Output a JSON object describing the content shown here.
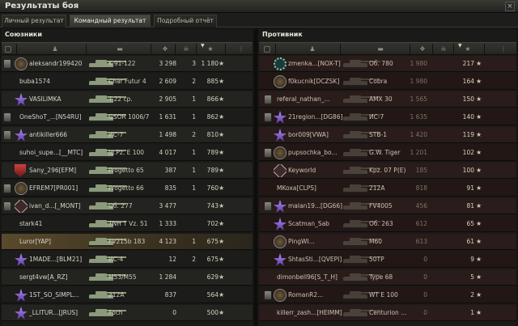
{
  "window": {
    "title": "Результаты боя",
    "close_label": "×"
  },
  "tabs": [
    {
      "label": "Личный результат",
      "active": false
    },
    {
      "label": "Командный результат",
      "active": true
    },
    {
      "label": "Подробный отчёт",
      "active": false
    }
  ],
  "allies": {
    "title": "Союзники",
    "rows": [
      {
        "name": "aleksandr199420",
        "vehicle": "K-91-122",
        "damage": "3 298",
        "frags": "3",
        "xp": "1 180",
        "badge": "plate",
        "icon": "round"
      },
      {
        "name": "buba1574",
        "vehicle": "Char Futur 4",
        "damage": "2 609",
        "frags": "2",
        "xp": "885",
        "badge": "",
        "icon": ""
      },
      {
        "name": "VASILIMKA",
        "vehicle": "T-22 ср.",
        "damage": "2 905",
        "frags": "1",
        "xp": "866",
        "badge": "",
        "icon": "star"
      },
      {
        "name": "OneShoT_...[N54RU]",
        "vehicle": "GSOR 1006/7",
        "damage": "1 631",
        "frags": "1",
        "xp": "862",
        "badge": "plate",
        "icon": ""
      },
      {
        "name": "antikiller666",
        "vehicle": "ИС-7",
        "damage": "1 498",
        "frags": "2",
        "xp": "810",
        "badge": "plate",
        "icon": "star"
      },
      {
        "name": "suhoi_supe...[__MTC]",
        "vehicle": "Jg.Pz. E 100",
        "damage": "4 017",
        "frags": "1",
        "xp": "789",
        "badge": "",
        "icon": ""
      },
      {
        "name": "Sany_296[EFM]",
        "vehicle": "Progetto 65",
        "damage": "387",
        "frags": "1",
        "xp": "789",
        "badge": "",
        "icon": "shield"
      },
      {
        "name": "EFREM7[PR001]",
        "vehicle": "Progetto 66",
        "damage": "835",
        "frags": "1",
        "xp": "760",
        "badge": "plate",
        "icon": "round"
      },
      {
        "name": "ivan_d...[_MONT]",
        "vehicle": "Об. 277",
        "damage": "3 477",
        "frags": "",
        "xp": "743",
        "badge": "plate",
        "icon": "diamond"
      },
      {
        "name": "stark41",
        "vehicle": "TNH T Vz. 51",
        "damage": "1 333",
        "frags": "",
        "xp": "702",
        "badge": "",
        "icon": ""
      },
      {
        "name": "Luror[YAP]",
        "vehicle": "FV215b 183",
        "damage": "4 123",
        "frags": "1",
        "xp": "675",
        "badge": "",
        "icon": "",
        "self": true
      },
      {
        "name": "1MADE...[BLM21]",
        "vehicle": "ИС-4",
        "damage": "12",
        "frags": "2",
        "xp": "675",
        "badge": "",
        "icon": "star"
      },
      {
        "name": "sergt4vw[A_RZ]",
        "vehicle": "M53/M55",
        "damage": "1 284",
        "frags": "",
        "xp": "629",
        "badge": "",
        "icon": ""
      },
      {
        "name": "1ST_SO_SIMPL...",
        "vehicle": "212A",
        "damage": "837",
        "frags": "",
        "xp": "564",
        "badge": "",
        "icon": "star"
      },
      {
        "name": "_LLITUR...[JRUS]",
        "vehicle": "Foch",
        "damage": "0",
        "frags": "",
        "xp": "500",
        "badge": "",
        "icon": "star"
      }
    ]
  },
  "enemies": {
    "title": "Противник",
    "rows": [
      {
        "name": "zmenka...[NOX-T]",
        "vehicle": "Об. 780",
        "damage": "1 980",
        "xp": "217",
        "badge": "",
        "icon": "gear"
      },
      {
        "name": "f0kucnik[DCZSK]",
        "vehicle": "Cobra",
        "damage": "1 980",
        "xp": "164",
        "badge": "",
        "icon": "round"
      },
      {
        "name": "referal_nathan_...",
        "vehicle": "AMX 30",
        "damage": "1 565",
        "xp": "150",
        "badge": "plate",
        "icon": ""
      },
      {
        "name": "21region...[DG86]",
        "vehicle": "ИС-7",
        "damage": "1 635",
        "xp": "140",
        "badge": "plate",
        "icon": "star"
      },
      {
        "name": "bor009[VWA]",
        "vehicle": "STB-1",
        "damage": "1 420",
        "xp": "119",
        "badge": "",
        "icon": "star"
      },
      {
        "name": "pupsochka_bo...",
        "vehicle": "G.W. Tiger",
        "damage": "1 201",
        "xp": "102",
        "badge": "plate",
        "icon": "round"
      },
      {
        "name": "Keyworld",
        "vehicle": "Kpz. 07 P(E)",
        "damage": "185",
        "xp": "100",
        "badge": "",
        "icon": "diamond"
      },
      {
        "name": "MKoxa[CLPS]",
        "vehicle": "212A",
        "damage": "818",
        "xp": "91",
        "badge": "",
        "icon": ""
      },
      {
        "name": "malan19...[DG66]",
        "vehicle": "FV4005",
        "damage": "456",
        "xp": "81",
        "badge": "plate",
        "icon": "star"
      },
      {
        "name": "Scatman_Sab",
        "vehicle": "Об. 263",
        "damage": "612",
        "xp": "65",
        "badge": "",
        "icon": "star"
      },
      {
        "name": "PingWI...",
        "vehicle": "M60",
        "damage": "613",
        "xp": "61",
        "badge": "",
        "icon": "round"
      },
      {
        "name": "ShtasSti...[QVEPI]",
        "vehicle": "50TP",
        "damage": "0",
        "xp": "9",
        "badge": "",
        "icon": "star"
      },
      {
        "name": "dimonbell96[S_T_H]",
        "vehicle": "Type 68",
        "damage": "0",
        "xp": "5",
        "badge": "",
        "icon": ""
      },
      {
        "name": "RomanR2...",
        "vehicle": "WT E 100",
        "damage": "0",
        "xp": "2",
        "badge": "plate",
        "icon": "round"
      },
      {
        "name": "killerr_zash...[HEIMM]",
        "vehicle": "Centurion ...",
        "damage": "0",
        "xp": "1",
        "badge": "",
        "icon": ""
      }
    ]
  },
  "star_glyph": "★"
}
